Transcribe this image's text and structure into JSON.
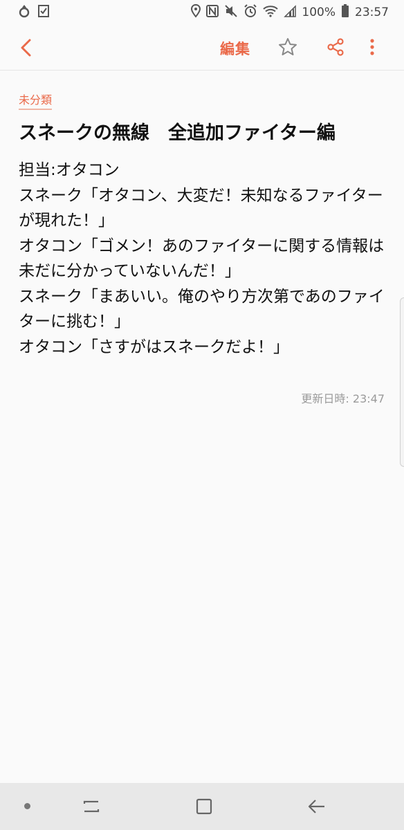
{
  "status_bar": {
    "battery_percent": "100%",
    "time": "23:57"
  },
  "toolbar": {
    "edit_label": "編集"
  },
  "note": {
    "category": "未分類",
    "title": "スネークの無線　全追加ファイター編",
    "body_lines": [
      "担当:オタコン",
      "スネーク「オタコン、大変だ！未知なるファイターが現れた！」",
      "オタコン「ゴメン！あのファイターに関する情報は未だに分かっていないんだ！」",
      "スネーク「まあいい。俺のやり方次第であのファイターに挑む！」",
      "オタコン「さすがはスネークだよ！」"
    ],
    "updated": "更新日時: 23:47"
  },
  "colors": {
    "accent": "#ea6a4a",
    "background": "#fafafa",
    "nav_bar": "#e8e8e8"
  },
  "icons": {
    "status_left": [
      "drop-icon",
      "checklist-icon"
    ],
    "status_right": [
      "location-icon",
      "nfc-icon",
      "mute-icon",
      "alarm-icon",
      "wifi-icon",
      "signal-icon",
      "battery-icon"
    ],
    "toolbar": [
      "back-chevron-icon",
      "star-icon",
      "share-icon",
      "more-vertical-icon"
    ],
    "nav": [
      "dot-icon",
      "recent-apps-icon",
      "home-icon",
      "back-arrow-icon"
    ]
  }
}
